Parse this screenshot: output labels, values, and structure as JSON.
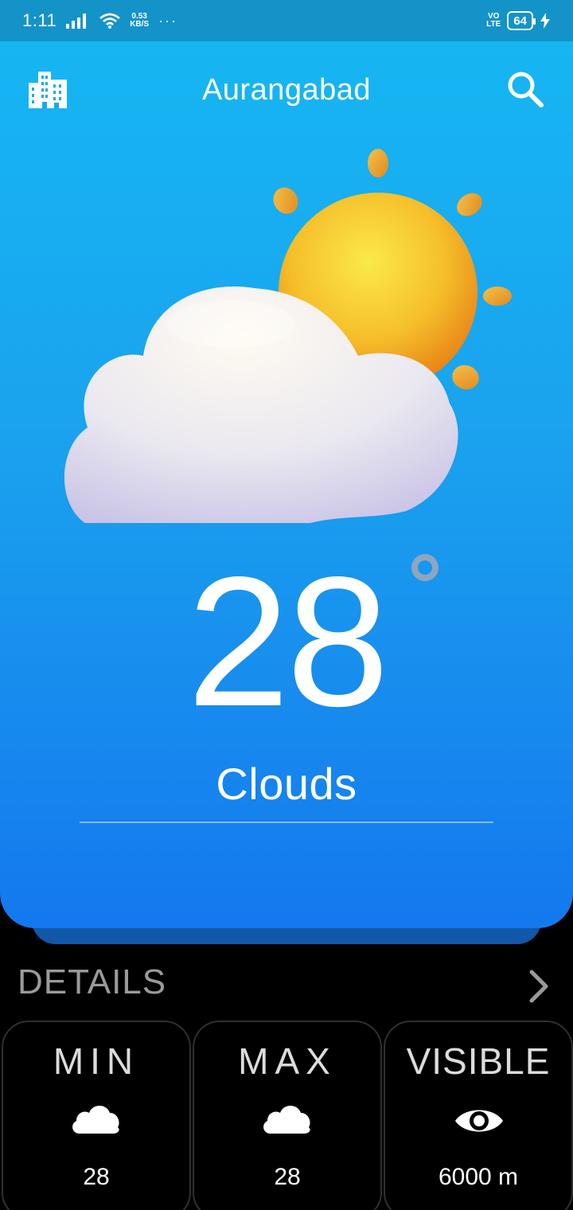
{
  "status_bar": {
    "time": "1:11",
    "speed_value": "0.53",
    "speed_unit": "KB/S",
    "more": "···",
    "volte_top": "VO",
    "volte_bottom": "LTE",
    "battery": "64"
  },
  "header": {
    "city": "Aurangabad",
    "left_icon": "city-buildings-icon",
    "right_icon": "search-icon"
  },
  "current": {
    "temperature": "28",
    "condition": "Clouds",
    "art": "partly-cloudy-sun"
  },
  "details": {
    "title": "DETAILS",
    "chevron_icon": "chevron-right-icon",
    "tiles": [
      {
        "label": "MIN",
        "icon": "cloud-icon",
        "value": "28"
      },
      {
        "label": "MAX",
        "icon": "cloud-icon",
        "value": "28"
      },
      {
        "label": "VISIBLE",
        "icon": "eye-icon",
        "value": "6000 m"
      }
    ]
  },
  "colors": {
    "status_bar": "#1493c8",
    "hero_top": "#16b6f2",
    "hero_bottom": "#1478ee",
    "background": "#000000",
    "details_title": "#9a9a9a"
  }
}
